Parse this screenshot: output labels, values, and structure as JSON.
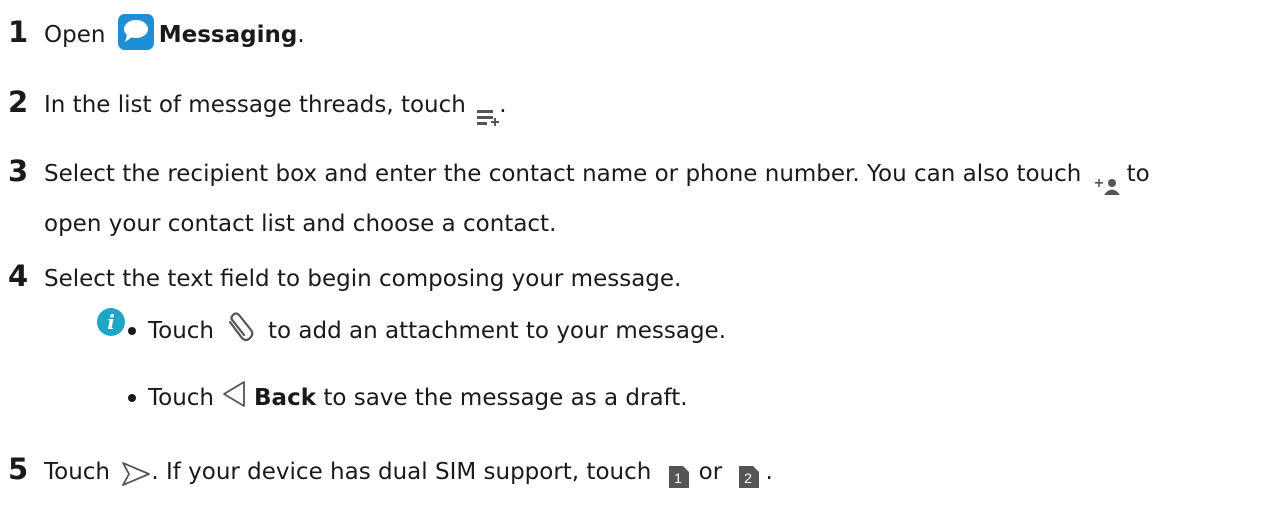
{
  "steps": [
    {
      "num": "1",
      "pre": "Open",
      "bold": "Messaging",
      "post": "."
    },
    {
      "num": "2",
      "pre": "In the list of message threads, touch",
      "post": "."
    },
    {
      "num": "3",
      "pre": "Select the recipient box and enter the contact name or phone number. You can also touch",
      "post": "to",
      "line2": "open your contact list and choose a contact."
    },
    {
      "num": "4",
      "pre": "Select the text field to begin composing your message."
    },
    {
      "num": "5",
      "pre": "Touch",
      "mid": ". If your device has dual SIM support, touch",
      "or": "or",
      "post": "."
    }
  ],
  "notes": [
    {
      "pre": "Touch",
      "post": "to add an attachment to your message."
    },
    {
      "pre": "Touch",
      "bold": "Back",
      "post": "to save the message as a draft."
    }
  ],
  "sim_labels": [
    "1",
    "2"
  ],
  "icons": {
    "messaging": "messaging-app-icon",
    "compose": "new-message-icon",
    "add_contact": "add-contact-icon",
    "info": "info-icon",
    "attach": "paperclip-icon",
    "back": "back-triangle-icon",
    "send": "send-icon",
    "sim1": "sim1-icon",
    "sim2": "sim2-icon"
  },
  "colors": {
    "accent": "#1e8ed8",
    "info": "#21a5c6",
    "icon_gray": "#555555"
  }
}
